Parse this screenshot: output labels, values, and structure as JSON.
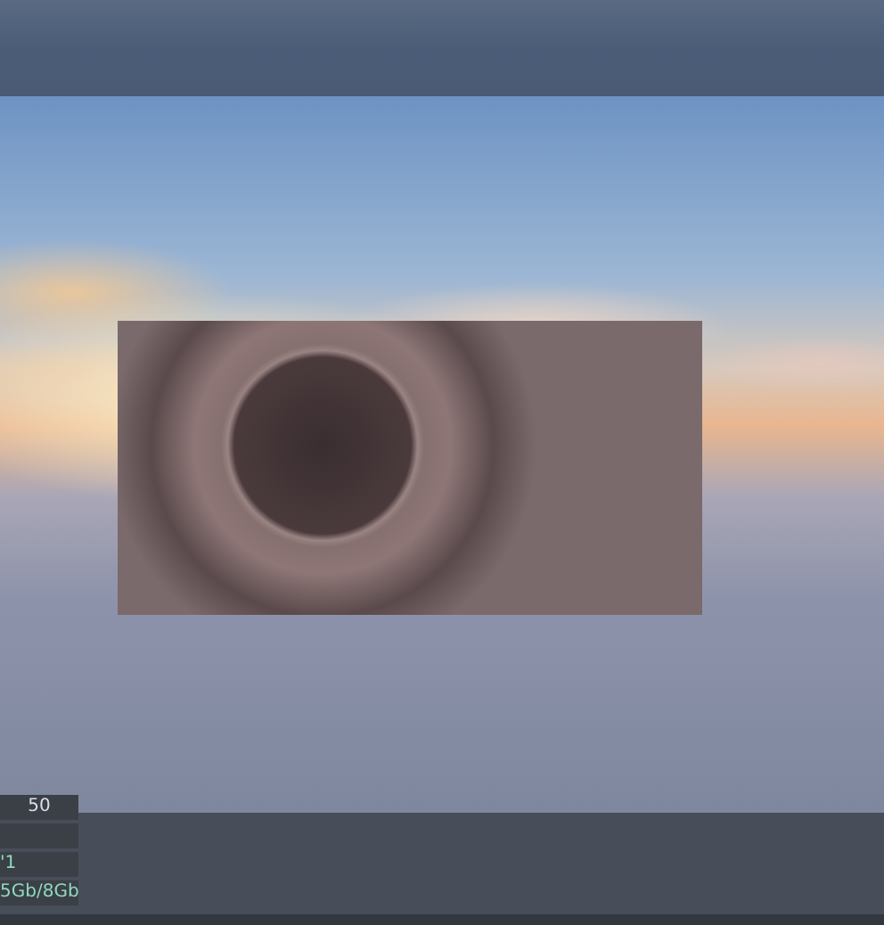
{
  "fields": [
    {
      "kind": "input",
      "value": "50"
    },
    {
      "kind": "input"
    },
    {
      "kind": "stat",
      "value": "'1"
    },
    {
      "kind": "stat",
      "value": "5Gb/8Gb"
    }
  ]
}
